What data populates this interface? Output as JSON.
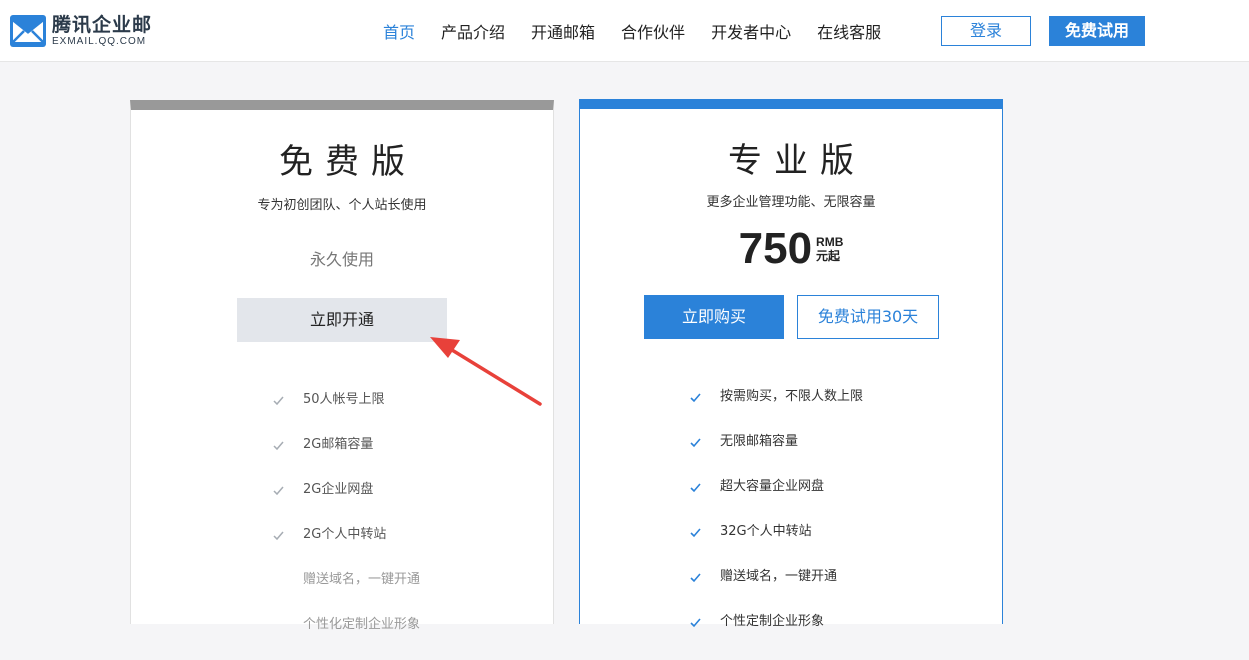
{
  "header": {
    "logo_cn": "腾讯企业邮",
    "logo_en": "EXMAIL.QQ.COM",
    "nav": [
      {
        "label": "首页",
        "active": true
      },
      {
        "label": "产品介绍",
        "active": false
      },
      {
        "label": "开通邮箱",
        "active": false
      },
      {
        "label": "合作伙伴",
        "active": false
      },
      {
        "label": "开发者中心",
        "active": false
      },
      {
        "label": "在线客服",
        "active": false
      }
    ],
    "login_label": "登录",
    "trial_label": "免费试用"
  },
  "plans": {
    "free": {
      "title": "免费版",
      "subtitle": "专为初创团队、个人站长使用",
      "duration": "永久使用",
      "action_label": "立即开通",
      "features": [
        {
          "text": "50人帐号上限",
          "checked": true
        },
        {
          "text": "2G邮箱容量",
          "checked": true
        },
        {
          "text": "2G企业网盘",
          "checked": true
        },
        {
          "text": "2G个人中转站",
          "checked": true
        },
        {
          "text": "赠送域名，一键开通",
          "checked": false
        },
        {
          "text": "个性化定制企业形象",
          "checked": false
        }
      ]
    },
    "pro": {
      "title": "专业版",
      "subtitle": "更多企业管理功能、无限容量",
      "price": "750",
      "price_currency": "RMB",
      "price_suffix": "元起",
      "buy_label": "立即购买",
      "trial_label": "免费试用30天",
      "features": [
        {
          "text": "按需购买，不限人数上限",
          "checked": true
        },
        {
          "text": "无限邮箱容量",
          "checked": true
        },
        {
          "text": "超大容量企业网盘",
          "checked": true
        },
        {
          "text": "32G个人中转站",
          "checked": true
        },
        {
          "text": "赠送域名，一键开通",
          "checked": true
        },
        {
          "text": "个性定制企业形象",
          "checked": true
        }
      ]
    }
  },
  "colors": {
    "accent": "#2b82d9",
    "free_bar": "#999999",
    "annotation": "#e8413a"
  },
  "icons": {
    "logo": "exmail-logo-icon",
    "check": "check-icon",
    "annotation": "red-arrow-annotation"
  }
}
